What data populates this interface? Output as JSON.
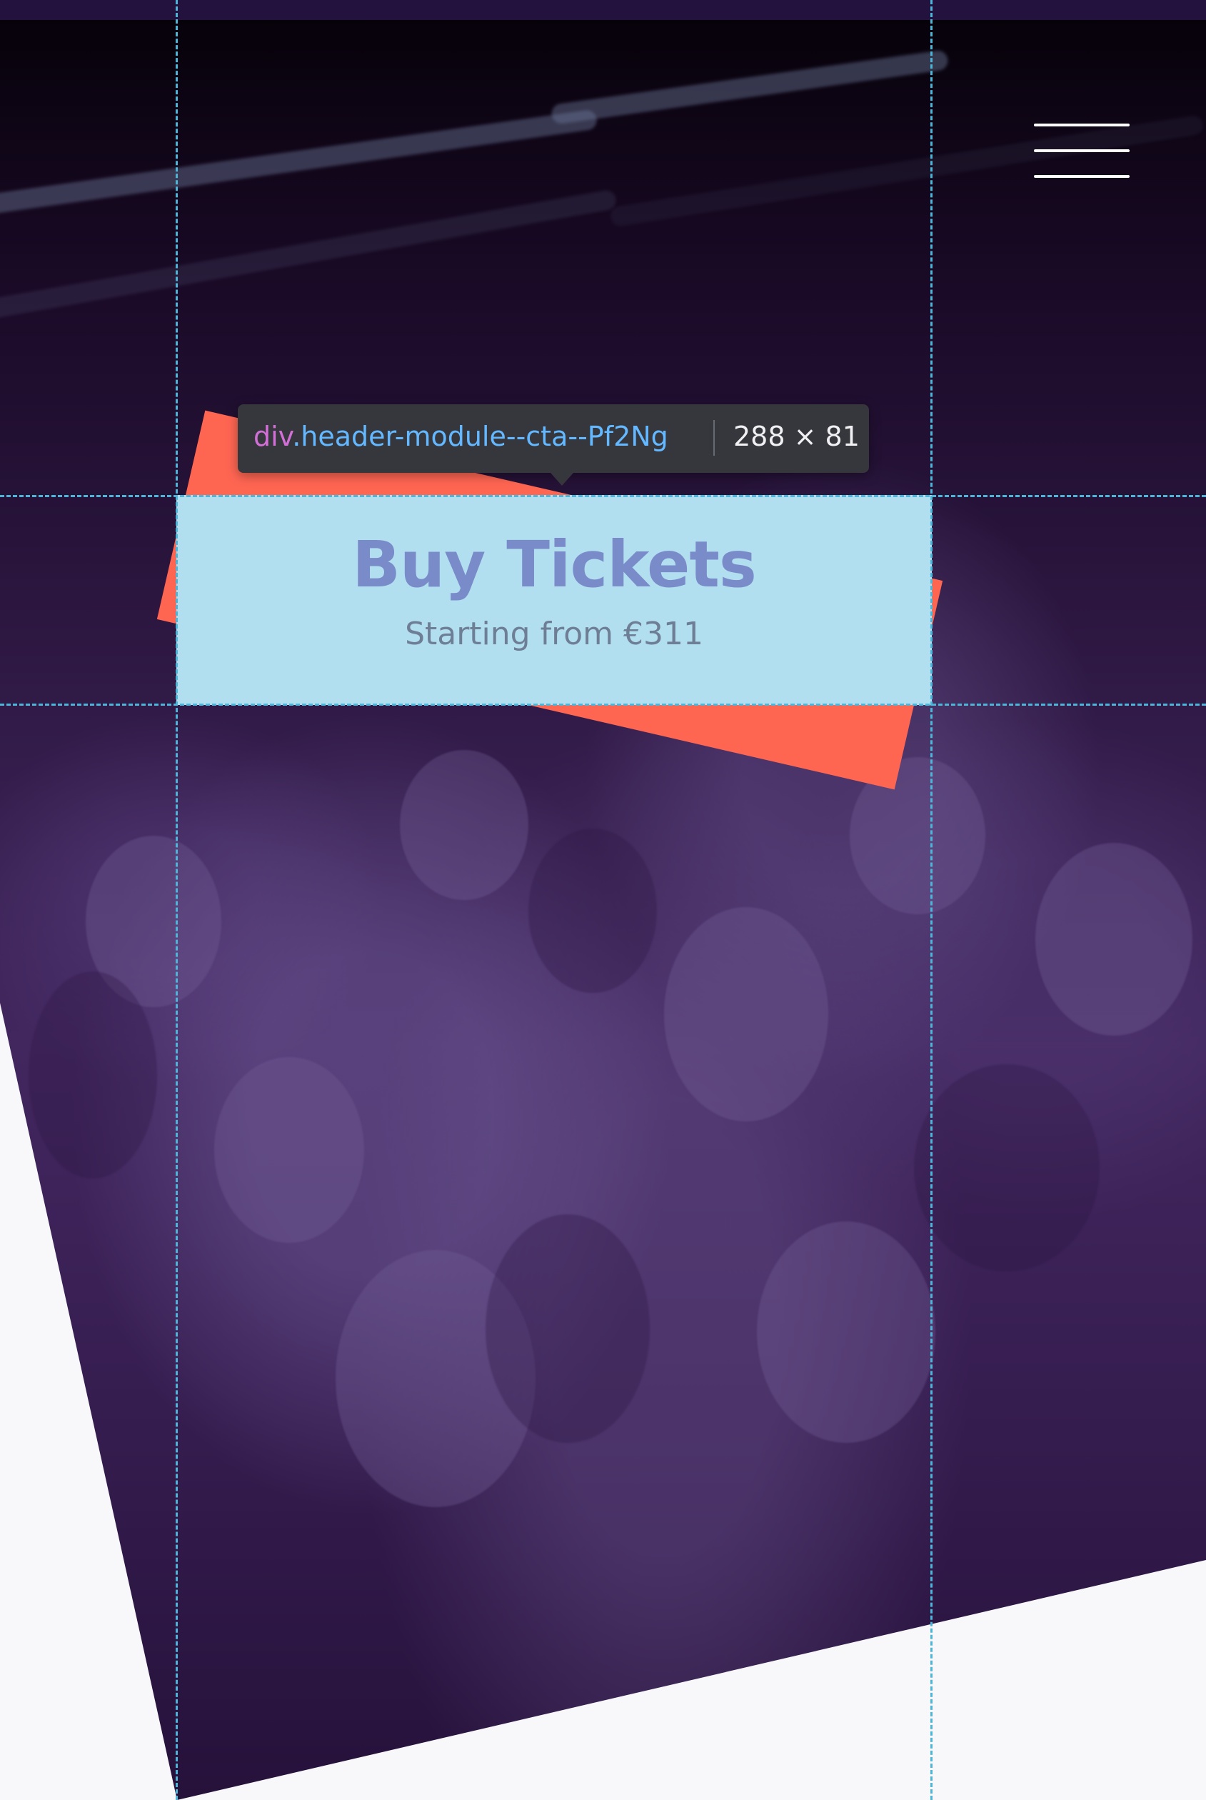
{
  "hero": {
    "background_image": "concert crowd photo"
  },
  "header": {
    "menu_icon": "hamburger-menu-icon"
  },
  "cta": {
    "title": "Buy Tickets",
    "subtitle": "Starting from €311"
  },
  "devtools": {
    "tooltip": {
      "element_tag": "div",
      "element_class": ".header-module--cta--Pf2Ng",
      "dimensions": "288 × 81"
    }
  },
  "colors": {
    "hero_overlay": "#3c1e57",
    "cta_highlight": "#b2dff0",
    "cta_ribbon": "#ff6652",
    "guide_lines": "#4cb6d9"
  }
}
